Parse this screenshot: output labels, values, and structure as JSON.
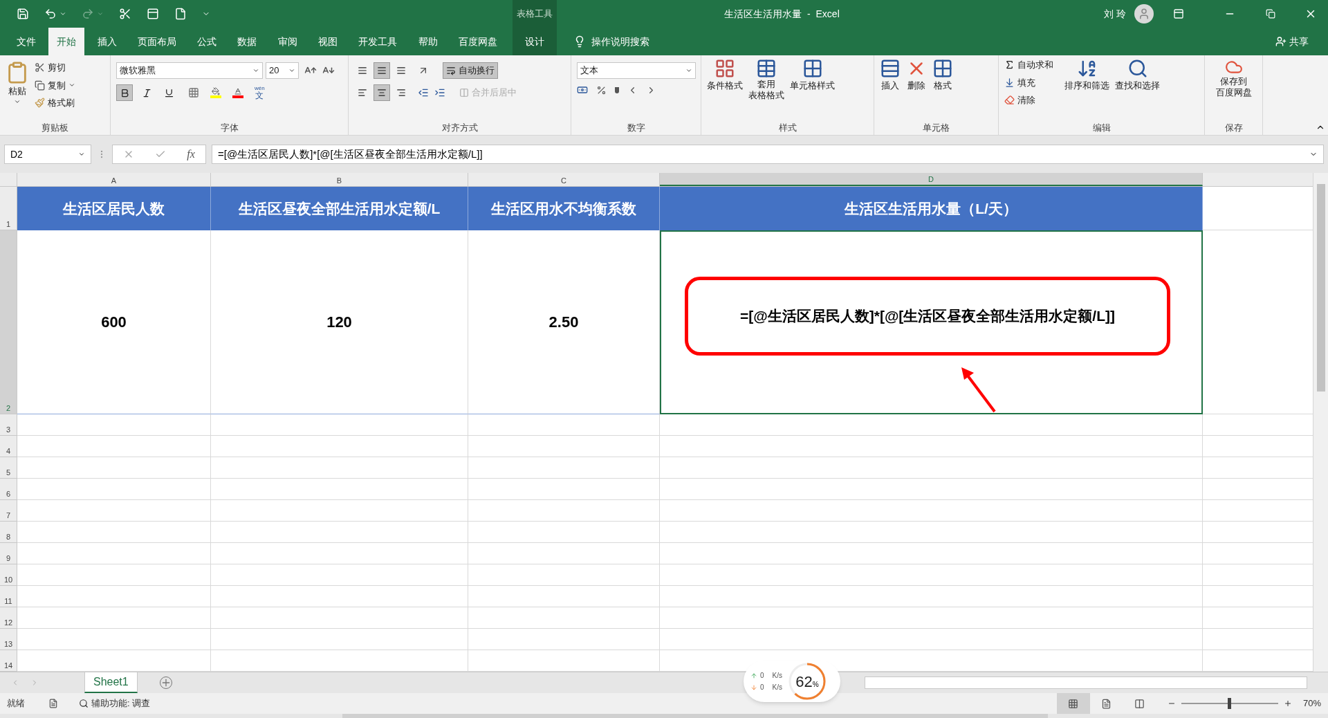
{
  "title_bar": {
    "context_group": "表格工具",
    "title": "生活区生活用水量  -  Excel",
    "user": "刘 玲"
  },
  "ribbon_tabs": [
    {
      "label": "文件",
      "selected": false,
      "contextual": false
    },
    {
      "label": "开始",
      "selected": true,
      "contextual": false
    },
    {
      "label": "插入",
      "selected": false,
      "contextual": false
    },
    {
      "label": "页面布局",
      "selected": false,
      "contextual": false
    },
    {
      "label": "公式",
      "selected": false,
      "contextual": false
    },
    {
      "label": "数据",
      "selected": false,
      "contextual": false
    },
    {
      "label": "审阅",
      "selected": false,
      "contextual": false
    },
    {
      "label": "视图",
      "selected": false,
      "contextual": false
    },
    {
      "label": "开发工具",
      "selected": false,
      "contextual": false
    },
    {
      "label": "帮助",
      "selected": false,
      "contextual": false
    },
    {
      "label": "百度网盘",
      "selected": false,
      "contextual": false
    },
    {
      "label": "设计",
      "selected": false,
      "contextual": true
    }
  ],
  "tell_me": "操作说明搜索",
  "share": "共享",
  "ribbon": {
    "clipboard": {
      "title": "剪贴板",
      "paste": "粘贴",
      "cut": "剪切",
      "copy": "复制",
      "format_painter": "格式刷"
    },
    "font": {
      "title": "字体",
      "font_name": "微软雅黑",
      "font_size": "20",
      "bold": true,
      "italic": false,
      "underline": false,
      "phonetic_top": "wén",
      "phonetic_bottom": "文"
    },
    "alignment": {
      "title": "对齐方式",
      "vertical": [
        {
          "selected": false
        },
        {
          "selected": true
        },
        {
          "selected": false
        }
      ],
      "horizontal": [
        {
          "selected": false
        },
        {
          "selected": true
        },
        {
          "selected": false
        }
      ],
      "wrap_text": {
        "label": "自动换行",
        "on": true
      },
      "merge": {
        "label": "合并后居中",
        "disabled": true
      }
    },
    "number": {
      "title": "数字",
      "format": "文本"
    },
    "styles": {
      "title": "样式",
      "conditional": "条件格式",
      "table_top": "套用",
      "table_bottom": "表格格式",
      "cell_styles": "单元格样式"
    },
    "cells": {
      "title": "单元格",
      "insert": "插入",
      "delete": "删除",
      "format": "格式"
    },
    "editing": {
      "title": "编辑",
      "autosum": "自动求和",
      "fill": "填充",
      "clear": "清除",
      "sort": "排序和筛选",
      "find": "查找和选择"
    },
    "save": {
      "title": "保存",
      "line1": "保存到",
      "line2": "百度网盘"
    }
  },
  "formula_bar": {
    "name_box": "D2",
    "fx": "fx",
    "formula": "=[@生活区居民人数]*[@[生活区昼夜全部生活用水定额/L]]"
  },
  "columns": [
    {
      "label": "A",
      "selected": false
    },
    {
      "label": "B",
      "selected": false
    },
    {
      "label": "C",
      "selected": false
    },
    {
      "label": "D",
      "selected": true
    }
  ],
  "header_row": {
    "number": "1",
    "selected": false,
    "cells": [
      "生活区居民人数",
      "生活区昼夜全部生活用水定额/L",
      "生活区用水不均衡系数",
      "生活区生活用水量（L/天）"
    ]
  },
  "data_row": {
    "number": "2",
    "selected": true,
    "cells": [
      "600",
      "120",
      "2.50",
      "=[@生活区居民人数]*[@[生活区昼夜全部生活用水定额/L]]"
    ]
  },
  "empty_rows": [
    "3",
    "4",
    "5",
    "6",
    "7",
    "8",
    "9",
    "10",
    "11",
    "12",
    "13",
    "14"
  ],
  "sheet_tabs": [
    {
      "label": "Sheet1",
      "selected": true
    }
  ],
  "net_widget": {
    "upload": "0",
    "upload_unit": "K/s",
    "download": "0",
    "download_unit": "K/s",
    "usage": "62",
    "usage_unit": "%",
    "level": 0.62
  },
  "status_bar": {
    "ready": "就绪",
    "accessibility": "辅助功能: 调查",
    "views": [
      {
        "selected": true
      },
      {
        "selected": false
      },
      {
        "selected": false
      }
    ],
    "zoom": {
      "label": "70%",
      "level": 0.5
    }
  }
}
